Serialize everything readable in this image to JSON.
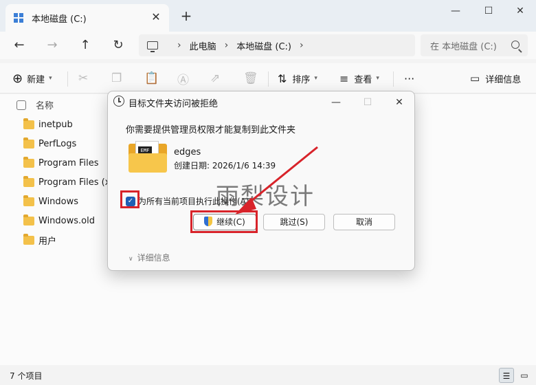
{
  "tab": {
    "title": "本地磁盘 (C:)",
    "close": "✕",
    "new_tab": "+"
  },
  "window_controls": {
    "minimize": "—",
    "maximize": "☐",
    "close": "✕"
  },
  "nav": {
    "back": "←",
    "forward": "→",
    "up": "↑",
    "refresh": "↻"
  },
  "breadcrumb": {
    "items": [
      "此电脑",
      "本地磁盘 (C:)"
    ],
    "separator": "›"
  },
  "search": {
    "placeholder": "在 本地磁盘 (C:)"
  },
  "toolbar": {
    "new_label": "新建",
    "sort_label": "排序",
    "view_label": "查看",
    "more": "···",
    "details_label": "详细信息"
  },
  "list": {
    "header_name": "名称",
    "items": [
      "inetpub",
      "PerfLogs",
      "Program Files",
      "Program Files (x8",
      "Windows",
      "Windows.old",
      "用户"
    ]
  },
  "status": {
    "count": "7 个项目"
  },
  "dialog": {
    "title": "目标文件夹访问被拒绝",
    "message": "你需要提供管理员权限才能复制到此文件夹",
    "file_name": "edges",
    "file_date": "创建日期: 2026/1/6 14:39",
    "folder_badge": "EMF",
    "checkbox_label": "为所有当前项目执行此操作(A)",
    "continue_label": "继续(C)",
    "skip_label": "跳过(S)",
    "cancel_label": "取消",
    "details_label": "详细信息",
    "checked": true
  },
  "watermark": "雨梨设计",
  "colors": {
    "highlight": "#d8232a",
    "accent": "#1f5fb4",
    "folder": "#f3c14a"
  }
}
